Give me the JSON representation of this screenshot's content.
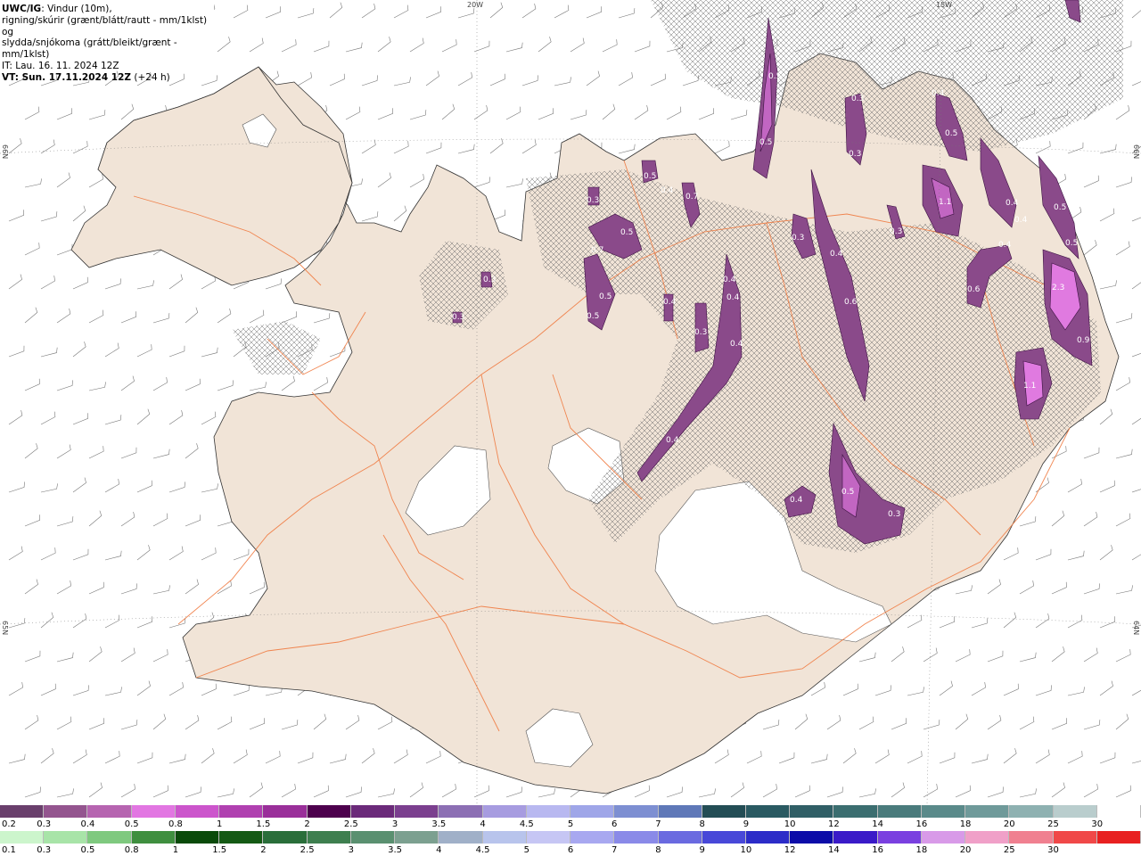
{
  "header": {
    "model": "UWC/IG",
    "line1": ": Vindur (10m),",
    "line2": "rigning/skúrir (grænt/blátt/rautt - mm/1klst) og",
    "line3": "slydda/snjókoma (grátt/bleikt/grænt - mm/1klst)",
    "it_line": "IT: Lau. 16. 11. 2024 12Z",
    "vt_line": "VT: Sun. 17.11.2024 12Z",
    "vt_offset": " (+24 h)"
  },
  "grid_labels": {
    "lon_20w": "20W",
    "lon_15w": "15W",
    "lat_66n_left": "66N",
    "lat_66n_right": "66N",
    "lat_65n_left": "65N",
    "lat_64n_right": "64N"
  },
  "precip_values": [
    "0.5",
    "0.5",
    "0.3",
    "0.4",
    "0.5",
    "0.3",
    "0.3",
    "0.3",
    "0.5",
    "0.5",
    "0.4",
    "0.7",
    "0.3",
    "0.5",
    "0.7",
    "0.4",
    "0.3",
    "0.4",
    "0.3",
    "0.5",
    "0.6",
    "0.4",
    "0.4",
    "0.4",
    "1.1",
    "0.4",
    "0.5",
    "0.4",
    "0.5",
    "0.4",
    "0.6",
    "2.3",
    "0.9",
    "1.1",
    "0.4",
    "0.5",
    "0.3",
    "0.4",
    "0.3"
  ],
  "legend": {
    "snow_labels": [
      "0.2",
      "0.3",
      "0.4",
      "0.5",
      "0.8",
      "1",
      "1.5",
      "2",
      "2.5",
      "3",
      "3.5",
      "4",
      "4.5",
      "5",
      "6",
      "7",
      "8",
      "9",
      "10",
      "12",
      "14",
      "16",
      "18",
      "20",
      "25",
      "30"
    ],
    "rain_labels": [
      "0.1",
      "0.3",
      "0.5",
      "0.8",
      "1",
      "1.5",
      "2",
      "2.5",
      "3",
      "3.5",
      "4",
      "4.5",
      "5",
      "6",
      "7",
      "8",
      "9",
      "10",
      "12",
      "14",
      "16",
      "18",
      "20",
      "25",
      "30"
    ],
    "snow_colors": [
      "#6a3f6c",
      "#94558f",
      "#b664b0",
      "#e276e2",
      "#cc55cc",
      "#b040b0",
      "#9a2f9a",
      "#4d004d",
      "#6b2a7a",
      "#7b3f8f",
      "#8c6fb4",
      "#a79ce0",
      "#b8b8f0",
      "#9fa6e8",
      "#7d8fd2",
      "#5f78b8",
      "#234d55",
      "#2a5a62",
      "#305f66",
      "#3b6e70",
      "#4a7b7c",
      "#5a8a8a",
      "#6f9a9a",
      "#8eb1b1",
      "#b9cdcd",
      "#ffffff"
    ],
    "rain_colors": [
      "#ccf5cc",
      "#a8e4a8",
      "#7fc97f",
      "#3f8f3f",
      "#0a4a0a",
      "#155a15",
      "#2a6e3a",
      "#3e7f4f",
      "#5a9070",
      "#7ca090",
      "#a0b0c8",
      "#b8c4ec",
      "#c6c6f4",
      "#a8a8f0",
      "#8a8ae8",
      "#6a6ae0",
      "#4848d8",
      "#2c2cc8",
      "#0c0ca8",
      "#3a1ac8",
      "#7a40e0",
      "#d89ae8",
      "#f0a0c8",
      "#f08090",
      "#f04848",
      "#e82020"
    ]
  }
}
